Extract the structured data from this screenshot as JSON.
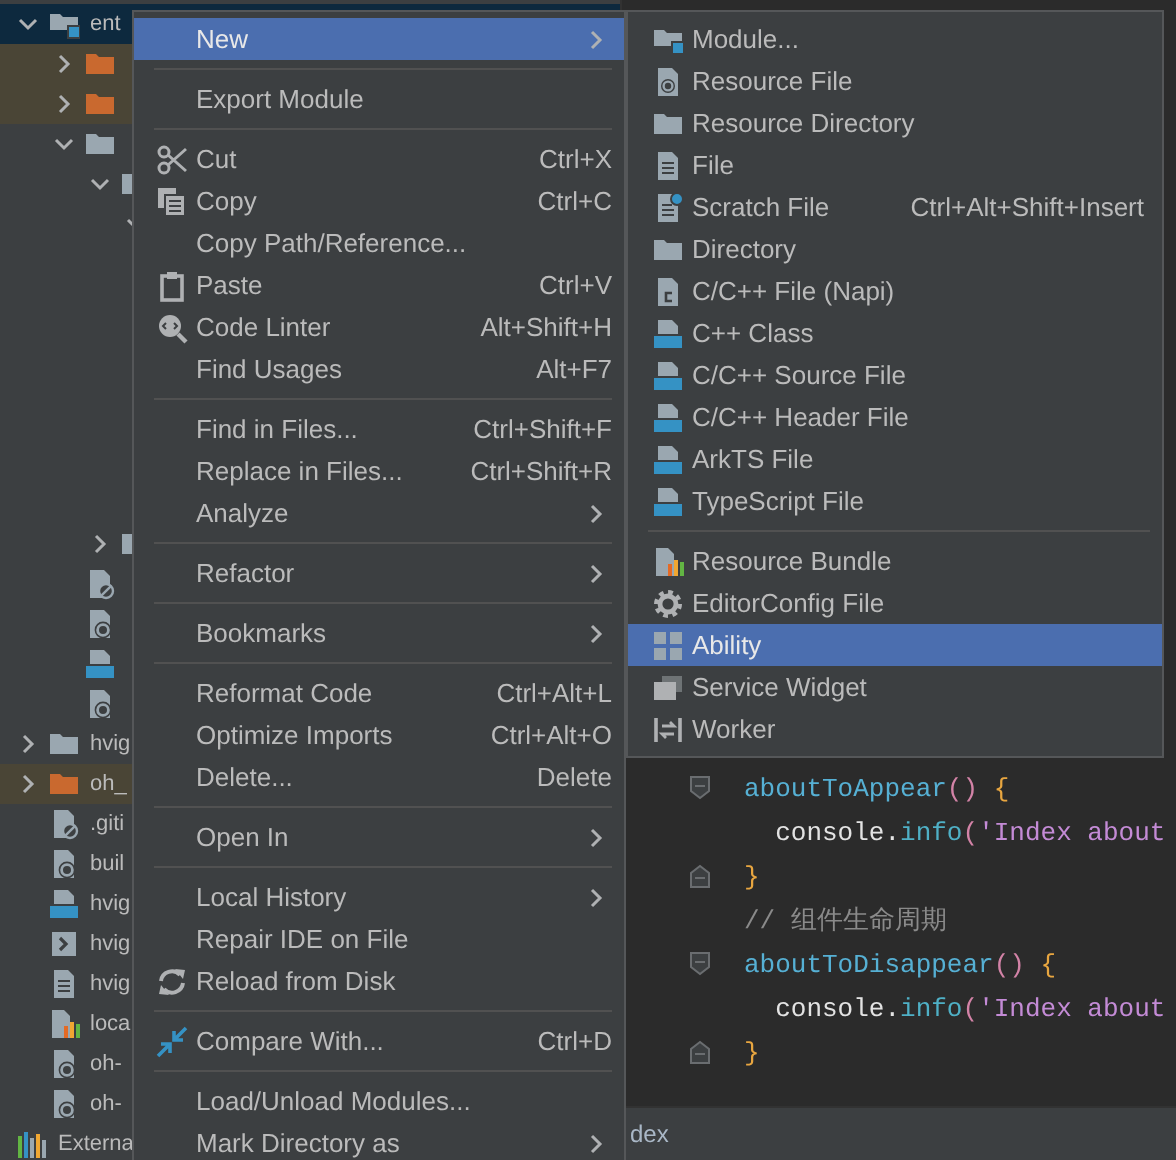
{
  "project_tree": {
    "items": [
      {
        "label": "ent",
        "kind": "module",
        "expanded": true,
        "selected": true,
        "children": [
          {
            "kind": "excluded_folder",
            "expanded": false,
            "selected": false
          },
          {
            "kind": "excluded_folder",
            "expanded": false,
            "selected": false
          },
          {
            "kind": "folder",
            "expanded": true,
            "selected": false,
            "children": [
              {
                "kind": "folder",
                "expanded": true,
                "selected": false,
                "children": [
                  {
                    "expanded": true,
                    "selected": false
                  }
                ]
              },
              {
                "kind": "folder",
                "expanded": false,
                "selected": false
              }
            ]
          },
          {
            "kind": "ignore_file",
            "selected": false
          },
          {
            "kind": "config_file",
            "selected": false
          },
          {
            "kind": "ts_file",
            "selected": false
          },
          {
            "kind": "config_file",
            "selected": false
          }
        ]
      },
      {
        "label": "hvig",
        "kind": "folder",
        "expanded": false,
        "selected": false
      },
      {
        "label": "oh_",
        "kind": "excluded_folder",
        "expanded": false,
        "selected": false
      },
      {
        "label": ".giti",
        "kind": "ignore_file",
        "selected": false
      },
      {
        "label": "buil",
        "kind": "config_file",
        "selected": false
      },
      {
        "label": "hvig",
        "kind": "ts_file",
        "selected": false
      },
      {
        "label": "hvig",
        "kind": "script_file",
        "selected": false
      },
      {
        "label": "hvig",
        "kind": "text_file",
        "selected": false
      },
      {
        "label": "loca",
        "kind": "bundle_file",
        "selected": false
      },
      {
        "label": "oh-",
        "kind": "config_file",
        "selected": false
      },
      {
        "label": "oh-",
        "kind": "config_file",
        "selected": false
      },
      {
        "label": "Externa",
        "kind": "library",
        "selected": false
      }
    ]
  },
  "editor": {
    "lines": [
      {
        "kind": "opener",
        "tokens": [
          {
            "text": "aboutToAppear",
            "kind": "function"
          },
          {
            "text": "()",
            "kind": "paren"
          },
          {
            "text": " {",
            "kind": "brace"
          }
        ]
      },
      {
        "kind": "body",
        "tokens": [
          {
            "text": "  console",
            "kind": "plain"
          },
          {
            "text": ".",
            "kind": "plain"
          },
          {
            "text": "info",
            "kind": "method"
          },
          {
            "text": "(",
            "kind": "paren"
          },
          {
            "text": "'Index about",
            "kind": "string"
          }
        ]
      },
      {
        "kind": "closer",
        "tokens": [
          {
            "text": "}",
            "kind": "brace"
          }
        ]
      },
      {
        "kind": "body",
        "tokens": [
          {
            "text": "// 组件生命周期",
            "kind": "comment"
          }
        ]
      },
      {
        "kind": "opener",
        "tokens": [
          {
            "text": "aboutToDisappear",
            "kind": "function"
          },
          {
            "text": "()",
            "kind": "paren"
          },
          {
            "text": " {",
            "kind": "brace"
          }
        ]
      },
      {
        "kind": "body",
        "tokens": [
          {
            "text": "  console",
            "kind": "plain"
          },
          {
            "text": ".",
            "kind": "plain"
          },
          {
            "text": "info",
            "kind": "method"
          },
          {
            "text": "(",
            "kind": "paren"
          },
          {
            "text": "'Index about",
            "kind": "string"
          }
        ]
      },
      {
        "kind": "closer",
        "tokens": [
          {
            "text": "}",
            "kind": "brace"
          }
        ]
      }
    ]
  },
  "status_bar": {
    "breadcrumb": "dex"
  },
  "context_menu": {
    "items": [
      {
        "kind": "item",
        "label": "New",
        "submenu": true,
        "selected": true
      },
      {
        "kind": "separator"
      },
      {
        "kind": "item",
        "label": "Export Module",
        "selected": false
      },
      {
        "kind": "separator"
      },
      {
        "kind": "item",
        "label": "Cut",
        "shortcut": "Ctrl+X",
        "selected": false
      },
      {
        "kind": "item",
        "label": "Copy",
        "shortcut": "Ctrl+C",
        "selected": false
      },
      {
        "kind": "item",
        "label": "Copy Path/Reference...",
        "selected": false
      },
      {
        "kind": "item",
        "label": "Paste",
        "shortcut": "Ctrl+V",
        "selected": false
      },
      {
        "kind": "item",
        "label": "Code Linter",
        "shortcut": "Alt+Shift+H",
        "selected": false
      },
      {
        "kind": "item",
        "label": "Find Usages",
        "shortcut": "Alt+F7",
        "selected": false
      },
      {
        "kind": "separator"
      },
      {
        "kind": "item",
        "label": "Find in Files...",
        "shortcut": "Ctrl+Shift+F",
        "selected": false
      },
      {
        "kind": "item",
        "label": "Replace in Files...",
        "shortcut": "Ctrl+Shift+R",
        "selected": false
      },
      {
        "kind": "item",
        "label": "Analyze",
        "submenu": true,
        "selected": false
      },
      {
        "kind": "separator"
      },
      {
        "kind": "item",
        "label": "Refactor",
        "submenu": true,
        "selected": false
      },
      {
        "kind": "separator"
      },
      {
        "kind": "item",
        "label": "Bookmarks",
        "submenu": true,
        "selected": false
      },
      {
        "kind": "separator"
      },
      {
        "kind": "item",
        "label": "Reformat Code",
        "shortcut": "Ctrl+Alt+L",
        "selected": false
      },
      {
        "kind": "item",
        "label": "Optimize Imports",
        "shortcut": "Ctrl+Alt+O",
        "selected": false
      },
      {
        "kind": "item",
        "label": "Delete...",
        "shortcut": "Delete",
        "selected": false
      },
      {
        "kind": "separator"
      },
      {
        "kind": "item",
        "label": "Open In",
        "submenu": true,
        "selected": false
      },
      {
        "kind": "separator"
      },
      {
        "kind": "item",
        "label": "Local History",
        "submenu": true,
        "selected": false
      },
      {
        "kind": "item",
        "label": "Repair IDE on File",
        "selected": false
      },
      {
        "kind": "item",
        "label": "Reload from Disk",
        "selected": false
      },
      {
        "kind": "separator"
      },
      {
        "kind": "item",
        "label": "Compare With...",
        "shortcut": "Ctrl+D",
        "selected": false
      },
      {
        "kind": "separator"
      },
      {
        "kind": "item",
        "label": "Load/Unload Modules...",
        "selected": false
      },
      {
        "kind": "item",
        "label": "Mark Directory as",
        "submenu": true,
        "selected": false
      }
    ]
  },
  "new_submenu": {
    "items": [
      {
        "kind": "item",
        "label": "Module...",
        "selected": false
      },
      {
        "kind": "item",
        "label": "Resource File",
        "selected": false
      },
      {
        "kind": "item",
        "label": "Resource Directory",
        "selected": false
      },
      {
        "kind": "item",
        "label": "File",
        "selected": false
      },
      {
        "kind": "item",
        "label": "Scratch File",
        "shortcut": "Ctrl+Alt+Shift+Insert",
        "selected": false
      },
      {
        "kind": "item",
        "label": "Directory",
        "selected": false
      },
      {
        "kind": "item",
        "label": "C/C++ File (Napi)",
        "selected": false
      },
      {
        "kind": "item",
        "label": "C++ Class",
        "selected": false
      },
      {
        "kind": "item",
        "label": "C/C++ Source File",
        "selected": false
      },
      {
        "kind": "item",
        "label": "C/C++ Header File",
        "selected": false
      },
      {
        "kind": "item",
        "label": "ArkTS File",
        "selected": false
      },
      {
        "kind": "item",
        "label": "TypeScript File",
        "selected": false
      },
      {
        "kind": "separator"
      },
      {
        "kind": "item",
        "label": "Resource Bundle",
        "selected": false
      },
      {
        "kind": "item",
        "label": "EditorConfig File",
        "selected": false
      },
      {
        "kind": "item",
        "label": "Ability",
        "selected": true
      },
      {
        "kind": "item",
        "label": "Service Widget",
        "selected": false
      },
      {
        "kind": "item",
        "label": "Worker",
        "selected": false
      }
    ]
  }
}
